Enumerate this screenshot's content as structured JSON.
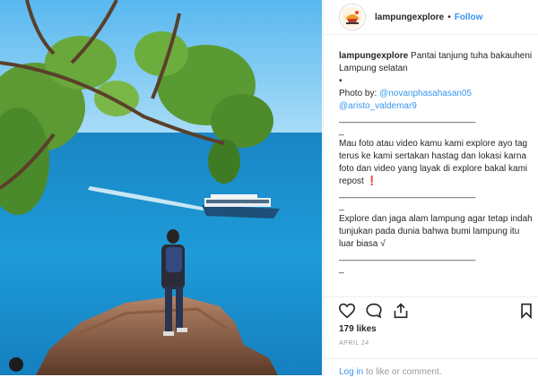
{
  "post": {
    "username": "lampungexplore",
    "separator": "•",
    "follow_label": "Follow",
    "avatar_icon": "lampung-explore-logo",
    "caption_title": "Pantai tanjung tuha bakauheni Lampung selatan",
    "bullet": "•",
    "photo_by_label": "Photo by:",
    "credit_1": "@novanphasahasan05",
    "credit_2": "@aristo_valdemar9",
    "divider": "______________________________",
    "underscore": "_",
    "paragraph_1": "Mau foto atau video kamu kami explore ayo tag terus ke kami sertakan hastag dan lokasi karna foto dan video yang layak di explore bakal kami repost ❗",
    "paragraph_2": "Explore dan jaga alam lampung agar tetap indah tunjukan pada dunia bahwa bumi lampung itu luar biasa √",
    "likes": "179 likes",
    "date": "APRIL 24",
    "login_link": "Log in",
    "login_rest": " to like or comment."
  },
  "icons": {
    "like": "heart-icon",
    "comment": "comment-icon",
    "share": "share-icon",
    "save": "bookmark-icon"
  },
  "colors": {
    "link": "#3897f0",
    "text": "#262626",
    "muted": "#999999"
  }
}
